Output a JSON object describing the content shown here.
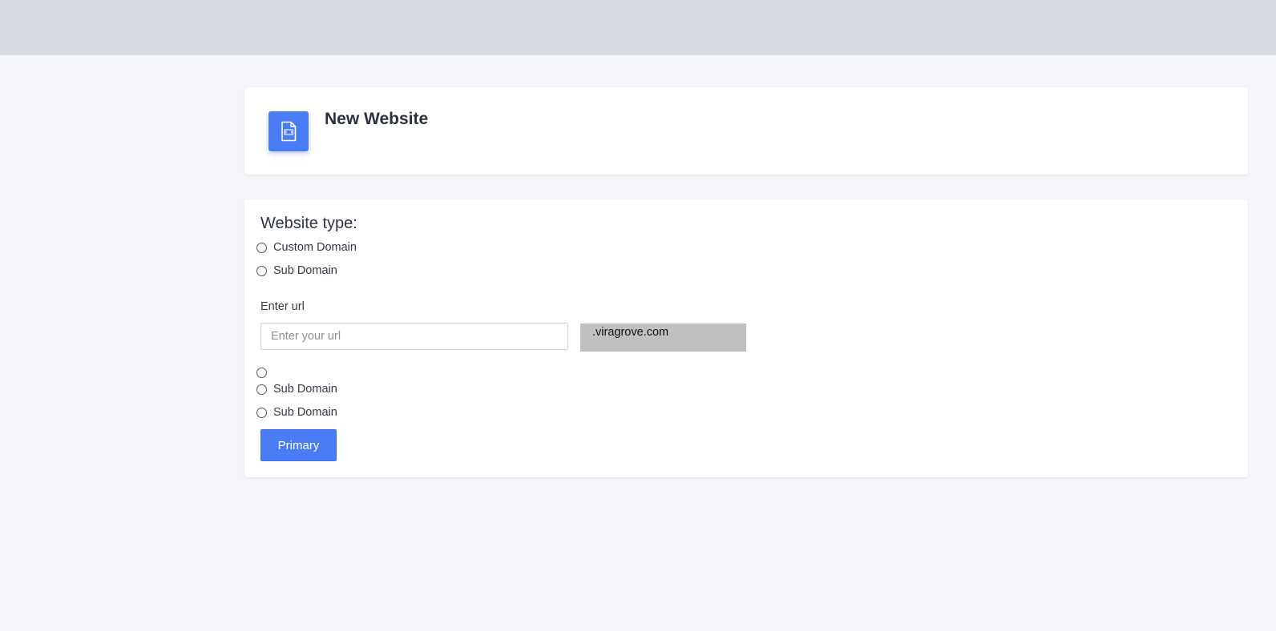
{
  "header": {
    "title": "New Website",
    "icon": "html-file-icon",
    "accent_color": "#4a7cf6"
  },
  "form": {
    "section_label": "Website type:",
    "radios_top": [
      {
        "label": "Custom Domain",
        "checked": false
      },
      {
        "label": "Sub Domain",
        "checked": false
      }
    ],
    "url": {
      "label": "Enter url",
      "placeholder": "Enter your url",
      "value": "",
      "suffix": ".viragrove.com"
    },
    "radios_bottom": [
      {
        "label": "",
        "checked": false
      },
      {
        "label": "Sub Domain",
        "checked": false
      },
      {
        "label": "Sub Domain",
        "checked": false
      }
    ],
    "submit_label": "Primary"
  },
  "colors": {
    "topbar": "#d6dae3",
    "page_background": "#f5f6fa",
    "primary": "#4a7cf6",
    "suffix_background": "#c0c0c0"
  }
}
